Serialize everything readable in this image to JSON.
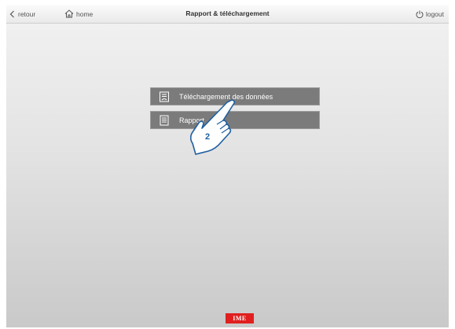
{
  "header": {
    "back_label": "retour",
    "home_label": "home",
    "title": "Rapport & téléchargement",
    "logout_label": "logout"
  },
  "menu": {
    "items": [
      {
        "label": "Téléchargement des données",
        "icon": "download-doc-icon"
      },
      {
        "label": "Rapport",
        "icon": "report-icon"
      }
    ]
  },
  "annotation": {
    "step_number": "2"
  },
  "footer": {
    "logo_text": "IME",
    "logo_color": "#e11f1f"
  }
}
